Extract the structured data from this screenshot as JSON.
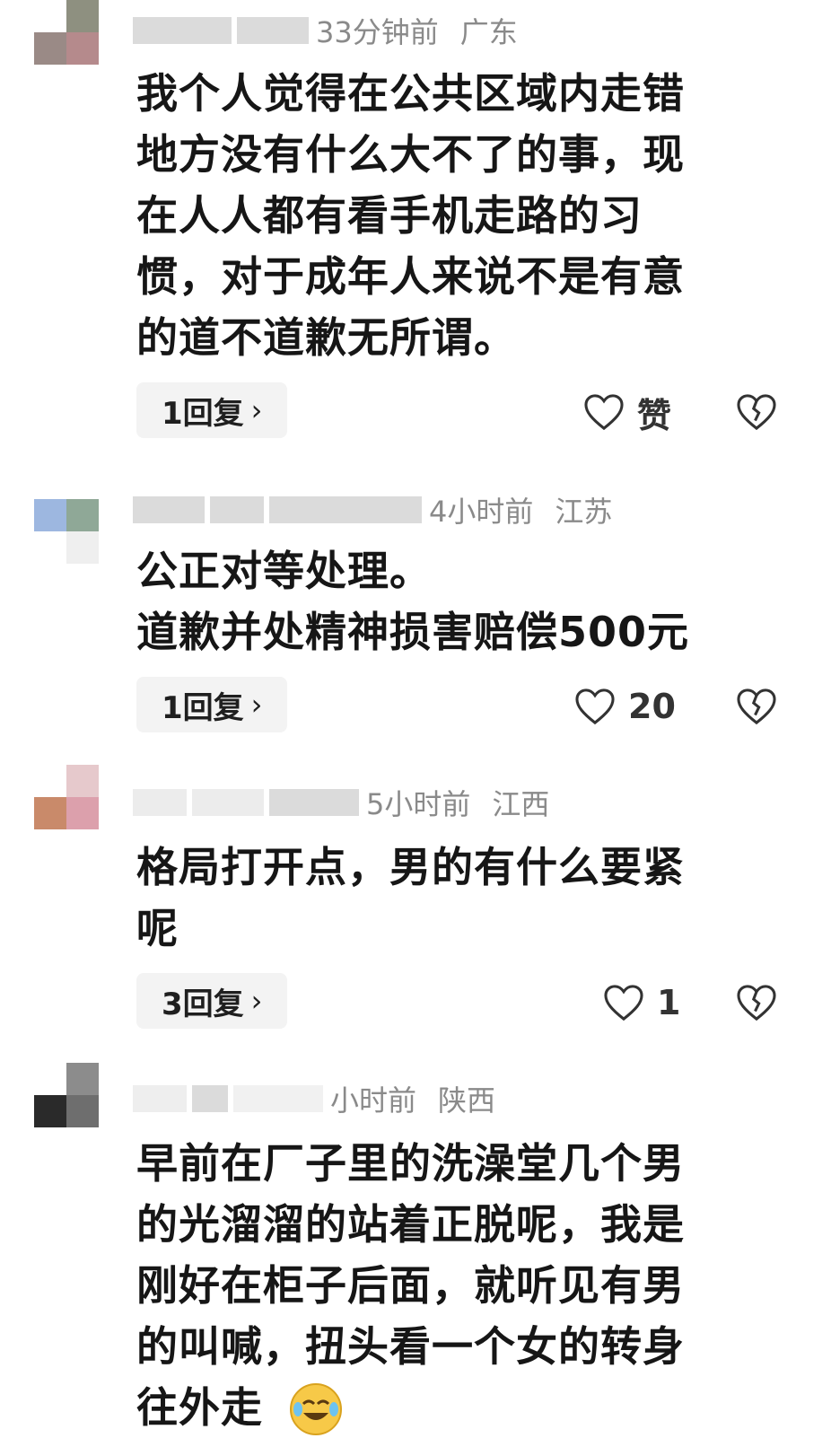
{
  "comments": [
    {
      "time": "33分钟前",
      "region": "广东",
      "lines": [
        "我个人觉得在公共区域内走错",
        "地方没有什么大不了的事，现",
        "在人人都有看手机走路的习",
        "惯，对于成年人来说不是有意",
        "的道不道歉无所谓。"
      ],
      "replies": "1回复",
      "like_label": "赞"
    },
    {
      "time": "4小时前",
      "region": "江苏",
      "lines": [
        "公正对等处理。",
        "道歉并处精神损害赔偿500元"
      ],
      "replies": "1回复",
      "like_label": "20"
    },
    {
      "time": "5小时前",
      "region": "江西",
      "lines": [
        "格局打开点，男的有什么要紧",
        "呢"
      ],
      "replies": "3回复",
      "like_label": "1"
    },
    {
      "time": "小时前",
      "region": "陕西",
      "lines": [
        "早前在厂子里的洗澡堂几个男",
        "的光溜溜的站着正脱呢，我是",
        "刚好在柜子后面，就听见有男",
        "的叫喊，扭头看一个女的转身",
        "往外走"
      ],
      "replies": "",
      "like_label": ""
    }
  ],
  "icons": {
    "like": "heart-outline-icon",
    "dislike": "broken-heart-icon",
    "chevron": "chevron-right-icon",
    "emoji": "crying-laughing-emoji-icon"
  },
  "chevron_glyph": "›"
}
